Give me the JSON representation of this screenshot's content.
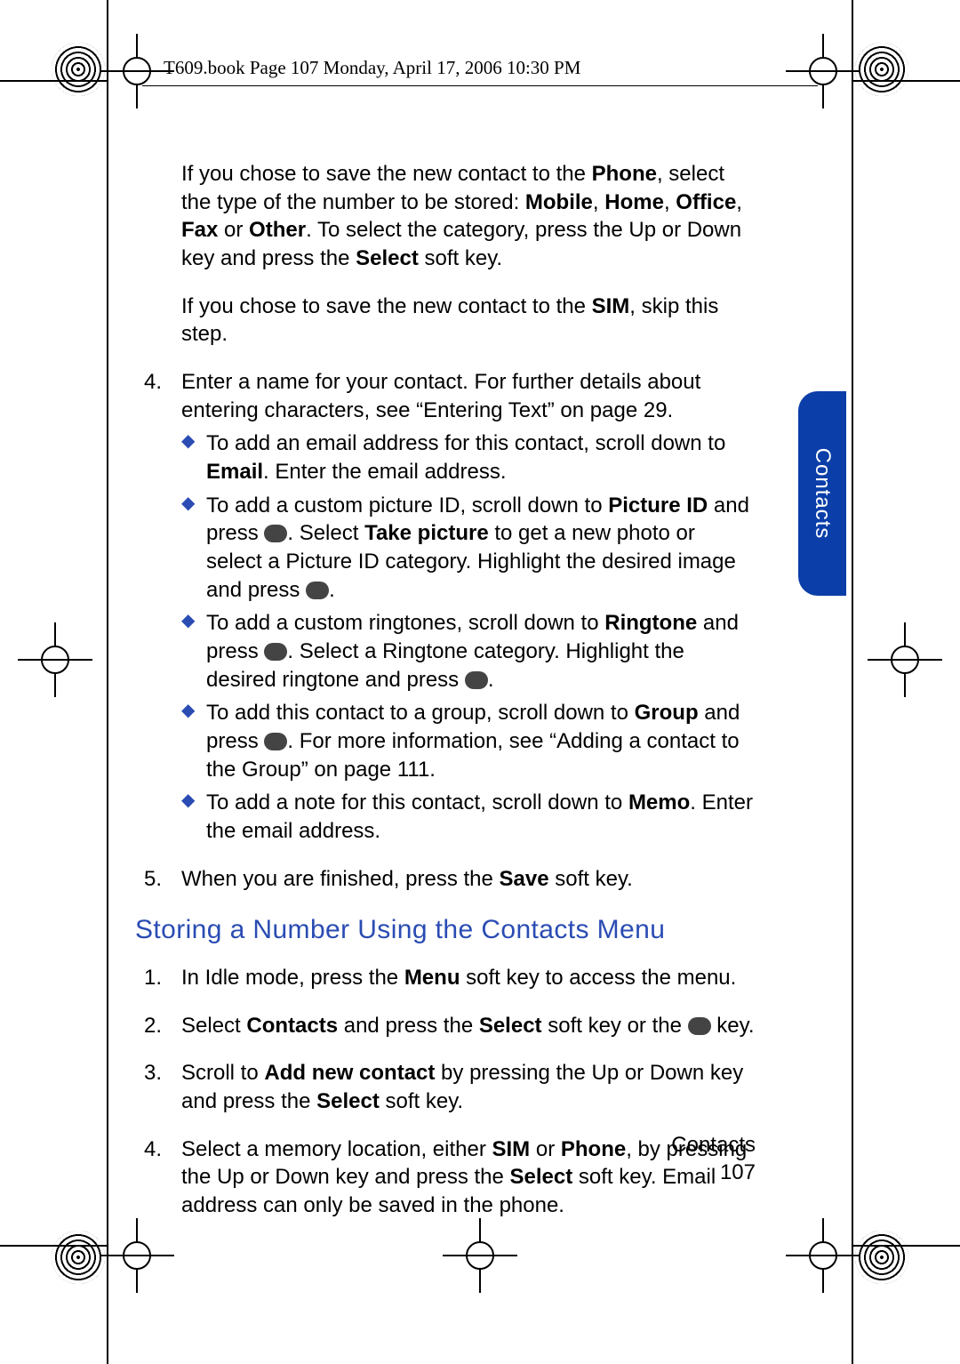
{
  "header_line": "T609.book  Page 107  Monday, April 17, 2006  10:30 PM",
  "side_tab": "Contacts",
  "footer_section": "Contacts",
  "footer_page": "107",
  "intro_para_a_before": "If you chose to save the new contact to the ",
  "bold_phone": "Phone",
  "intro_para_a_mid": ", select the type of the number to be stored: ",
  "bold_mobile": "Mobile",
  "comma1": ", ",
  "bold_home": "Home",
  "comma2": ", ",
  "bold_office": "Office",
  "comma3": ", ",
  "bold_fax": "Fax",
  "or_word": " or ",
  "bold_other": "Other",
  "intro_para_a_end": ". To select the category, press the Up or Down key and press the ",
  "bold_select": "Select",
  "softkey_tail": " soft key.",
  "sim_para_before": "If you chose to save the new contact to the ",
  "bold_sim": "SIM",
  "sim_para_after": ", skip this step.",
  "step4_text": "Enter a name for your contact. For further details about entering characters, see “Entering Text” on page 29.",
  "b1_before": "To add an email address for this contact, scroll down to ",
  "bold_email": "Email",
  "b1_after": ". Enter the email address.",
  "b2_before": "To add a custom picture ID, scroll down to ",
  "bold_pictureid": "Picture ID",
  "b2_mid1": " and press ",
  "b2_mid2": ". Select ",
  "bold_takepic": "Take picture",
  "b2_mid3": " to get a new photo or select a Picture ID category. Highlight the desired image and press ",
  "period": ".",
  "b3_before": "To add a custom ringtones, scroll down to ",
  "bold_ringtone": "Ringtone",
  "b3_mid1": " and press ",
  "b3_mid2": ". Select a Ringtone category. Highlight the desired ringtone and press ",
  "b4_before": "To add this contact to a group, scroll down to ",
  "bold_group": "Group",
  "b4_mid1": " and press ",
  "b4_mid2": ". For more information, see “Adding a contact to the Group” on page 111.",
  "b5_before": "To add a note for this contact, scroll down to ",
  "bold_memo": "Memo",
  "b5_after": ". Enter the email address.",
  "step5_before": "When you are finished, press the ",
  "bold_save": "Save",
  "section_title": "Storing a Number Using the Contacts Menu",
  "s1_before": "In Idle mode, press the ",
  "bold_menu": "Menu",
  "s1_after": " soft key to access the menu.",
  "s2_before": "Select ",
  "bold_contacts": "Contacts",
  "s2_mid1": " and press the ",
  "s2_mid2": " soft key or the ",
  "s2_after": " key.",
  "s3_before": "Scroll to ",
  "bold_addnew": "Add new contact",
  "s3_mid": " by pressing the Up or Down key and press the ",
  "s4_before": "Select a memory location, either ",
  "s4_or": " or ",
  "s4_mid": ", by pressing the Up or Down key and press the ",
  "s4_after": " soft key. Email address can only be saved in the phone.",
  "num4": "4.",
  "num5": "5.",
  "num1b": "1.",
  "num2b": "2.",
  "num3b": "3.",
  "num4b": "4."
}
